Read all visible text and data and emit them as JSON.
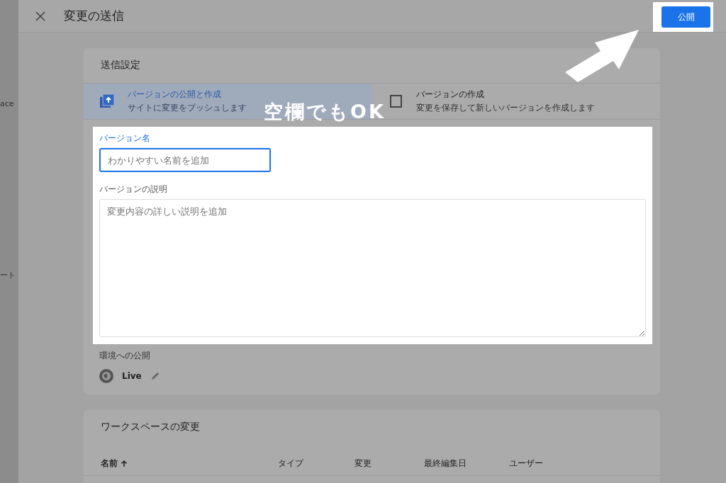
{
  "background_page": {
    "texts": [
      "ace",
      "ート"
    ]
  },
  "header": {
    "title": "変更の送信",
    "publish_button": "公開"
  },
  "submission_settings": {
    "title": "送信設定",
    "options": [
      {
        "title": "バージョンの公開と作成",
        "subtitle": "サイトに変更をプッシュします",
        "selected": true
      },
      {
        "title": "バージョンの作成",
        "subtitle": "変更を保存して新しいバージョンを作成します",
        "selected": false
      }
    ],
    "version_name": {
      "label": "バージョン名",
      "placeholder": "わかりやすい名前を追加"
    },
    "version_description": {
      "label": "バージョンの説明",
      "placeholder": "変更内容の詳しい説明を追加"
    },
    "environment": {
      "label": "環境への公開",
      "value": "Live"
    }
  },
  "workspace_changes": {
    "title": "ワークスペースの変更",
    "columns": [
      {
        "label": "名前",
        "sorted": true
      },
      {
        "label": "タイプ",
        "sorted": false
      },
      {
        "label": "変更",
        "sorted": false
      },
      {
        "label": "最終編集日",
        "sorted": false
      },
      {
        "label": "ユーザー",
        "sorted": false
      }
    ]
  },
  "annotation": {
    "text": "空欄でもOK"
  }
}
